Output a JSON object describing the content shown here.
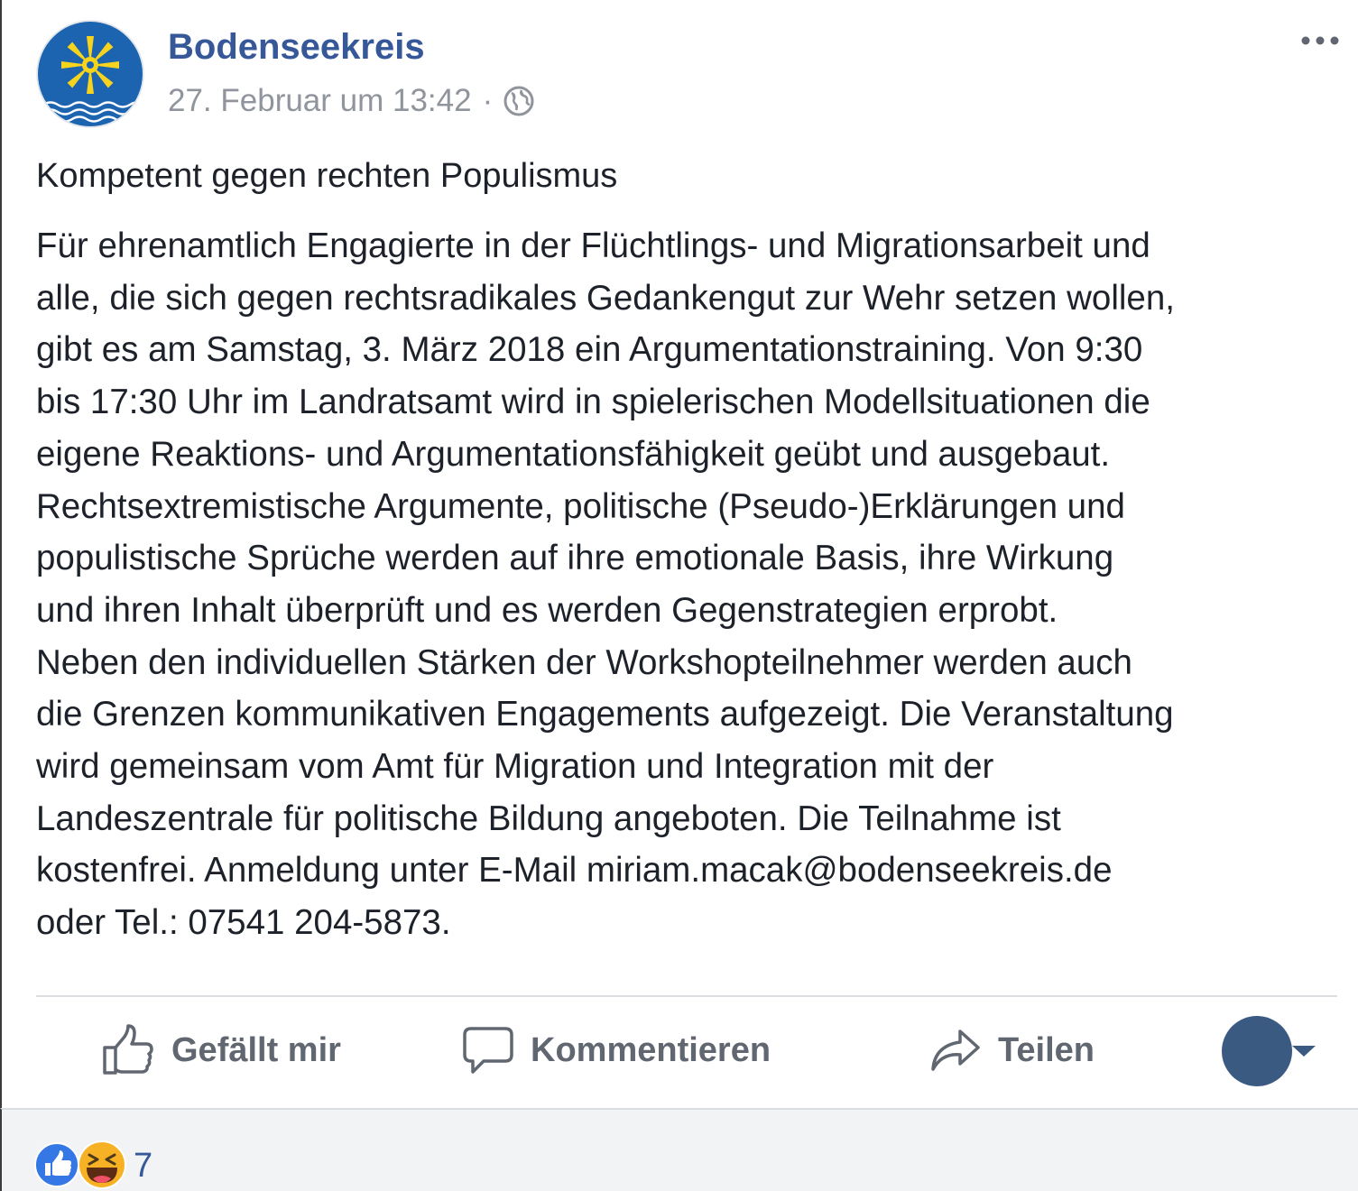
{
  "post": {
    "page_name": "Bodenseekreis",
    "timestamp": "27. Februar um 13:42",
    "separator": "·",
    "privacy_icon": "globe-icon",
    "more_icon": "more-options-icon",
    "title": "Kompetent gegen rechten Populismus",
    "body_lines": [
      "Für ehrenamtlich Engagierte in der Flüchtlings- und Migrationsarbeit und",
      "alle, die sich gegen rechtsradikales Gedankengut zur Wehr setzen wollen,",
      "gibt es am Samstag, 3. März 2018 ein Argumentationstraining. Von 9:30",
      "bis 17:30 Uhr im Landratsamt wird in spielerischen Modellsituationen die",
      "eigene Reaktions- und Argumentationsfähigkeit geübt und ausgebaut.",
      "Rechtsextremistische Argumente, politische (Pseudo-)Erklärungen und",
      "populistische Sprüche werden auf ihre emotionale Basis, ihre Wirkung",
      "und ihren Inhalt überprüft und es werden Gegenstrategien erprobt.",
      "Neben den individuellen Stärken der Workshopteilnehmer werden auch",
      "die Grenzen kommunikativen Engagements aufgezeigt. Die Veranstaltung",
      "wird gemeinsam vom Amt für Migration und Integration mit der",
      "Landeszentrale für politische Bildung angeboten. Die Teilnahme ist",
      "kostenfrei. Anmeldung unter E-Mail miriam.macak@bodenseekreis.de",
      "oder Tel.: 07541 204-5873."
    ]
  },
  "actions": {
    "like_label": "Gefällt mir",
    "comment_label": "Kommentieren",
    "share_label": "Teilen"
  },
  "reactions": {
    "types": [
      "like-reaction-icon",
      "haha-reaction-icon"
    ],
    "count": "7"
  },
  "colors": {
    "link_blue": "#365899",
    "text": "#1d2129",
    "muted": "#90949c",
    "action_gray": "#606770",
    "divider": "#dadde1",
    "footer_bg": "#f2f3f5",
    "like_blue": "#3578e5",
    "haha_yellow": "#f7b125",
    "logo_blue": "#1c64b0",
    "logo_yellow": "#f6d31c"
  }
}
